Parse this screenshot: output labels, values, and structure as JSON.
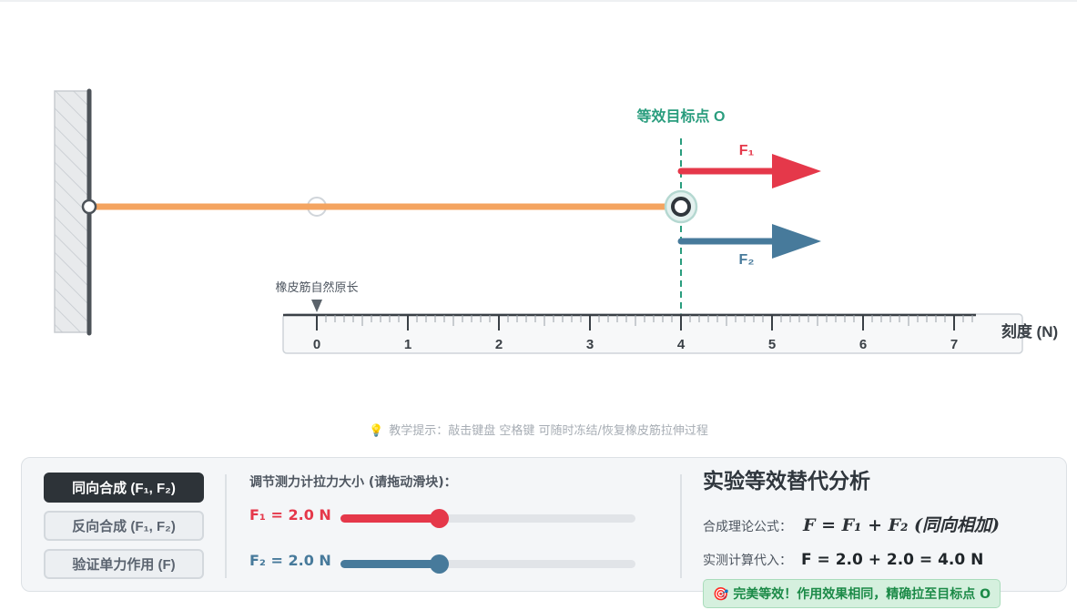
{
  "scene": {
    "target_label": "等效目标点 O",
    "natural_length_label": "橡皮筋自然原长",
    "ruler_unit_label": "刻度 (N)",
    "ruler_ticks": [
      "0",
      "1",
      "2",
      "3",
      "4",
      "5",
      "6",
      "7"
    ],
    "target_value_n": 4.0,
    "band_end_value_n": 4.0,
    "forces": [
      {
        "label": "F₁",
        "value_n": 2.0,
        "color": "#e5384a"
      },
      {
        "label": "F₂",
        "value_n": 2.0,
        "color": "#477a9b"
      }
    ],
    "band_color": "#f4a460"
  },
  "hint": {
    "icon": "lightbulb-icon",
    "text": "教学提示：敲击键盘 空格键 可随时冻结/恢复橡皮筋拉伸过程"
  },
  "modes": [
    {
      "label": "同向合成 (F₁, F₂)",
      "active": true
    },
    {
      "label": "反向合成 (F₁, F₂)",
      "active": false
    },
    {
      "label": "验证单力作用 (F)",
      "active": false
    }
  ],
  "controls": {
    "title": "调节测力计拉力大小 (请拖动滑块)：",
    "f1": {
      "label": "F₁ = 2.0 N",
      "value": 2.0,
      "max": 6.0,
      "color": "#e5384a"
    },
    "f2": {
      "label": "F₂ = 2.0 N",
      "value": 2.0,
      "max": 6.0,
      "color": "#477a9b"
    }
  },
  "analysis": {
    "title": "实验等效替代分析",
    "formula_label": "合成理论公式：",
    "formula": "F = F₁ + F₂ (同向相加)",
    "calc_label": "实测计算代入：",
    "calc": "F = 2.0 + 2.0 = 4.0 N",
    "result_icon": "target-icon",
    "result": "完美等效！作用效果相同，精确拉至目标点 O"
  }
}
